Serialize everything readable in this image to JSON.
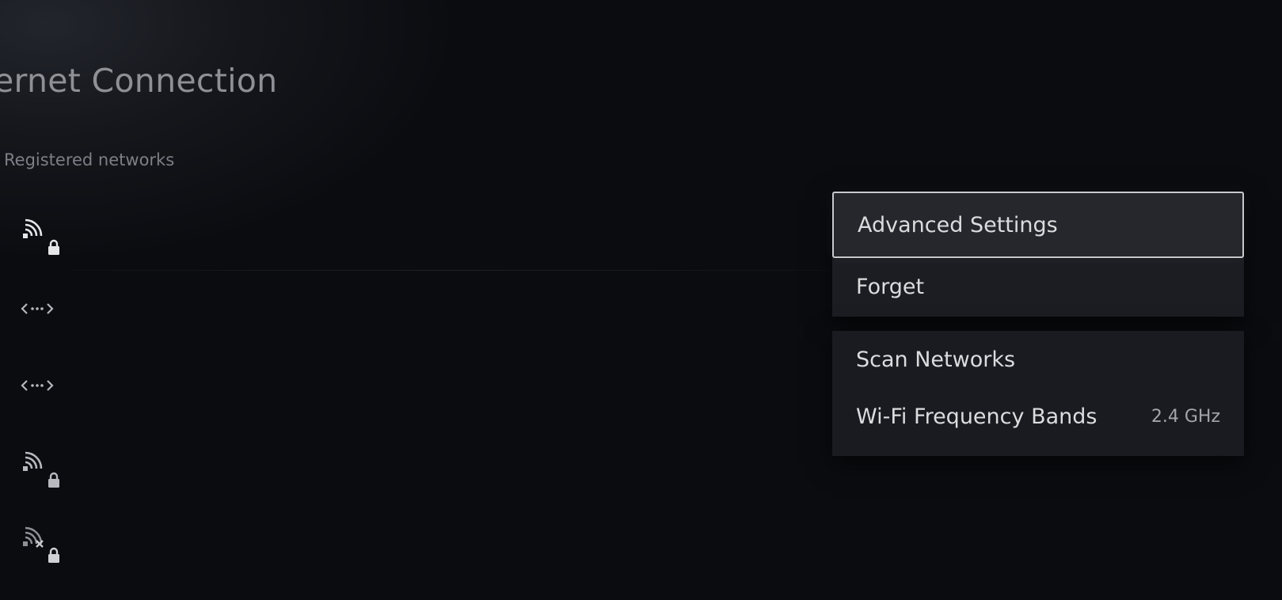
{
  "page": {
    "title": "ernet Connection",
    "section_label": "Registered networks"
  },
  "networks": [
    {
      "icon": "wifi-locked-icon",
      "status": "connected"
    },
    {
      "icon": "wired-ethernet-icon",
      "status": "wired"
    },
    {
      "icon": "wired-ethernet-icon",
      "status": "wired"
    },
    {
      "icon": "wifi-locked-icon",
      "status": "available"
    },
    {
      "icon": "wifi-unavailable-locked-icon",
      "status": "unavailable"
    }
  ],
  "menu": {
    "advanced_settings": "Advanced Settings",
    "forget": "Forget",
    "scan_networks": "Scan Networks",
    "wifi_bands": "Wi-Fi Frequency Bands",
    "wifi_bands_value": "2.4 GHz"
  },
  "colors": {
    "background": "#0c0d11",
    "menu_background": "#1b1d22",
    "focus_border": "#c8c9cc",
    "text": "#dcdcde"
  }
}
